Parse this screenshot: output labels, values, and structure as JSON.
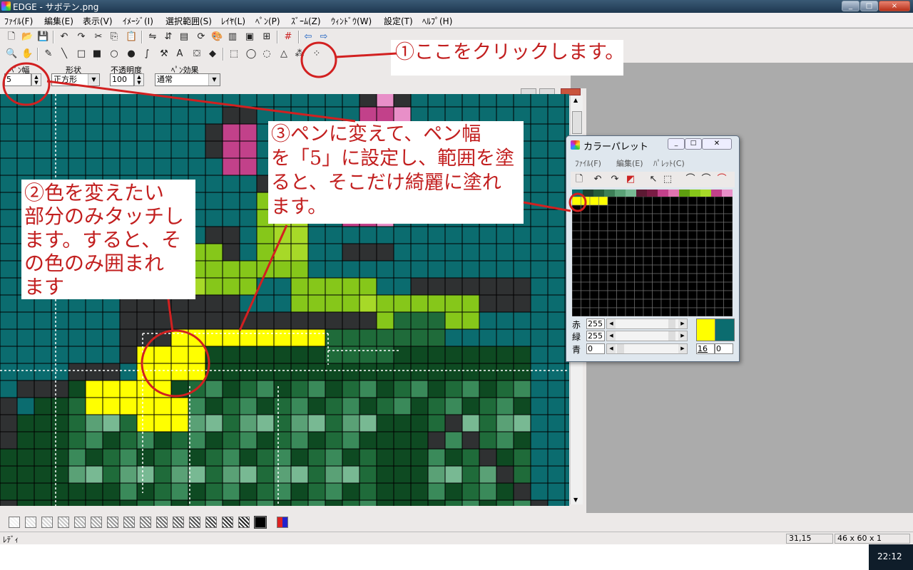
{
  "window": {
    "title": "EDGE - サボテン.png",
    "controls": [
      "_",
      "□",
      "×"
    ]
  },
  "menu": [
    "ﾌｧｲﾙ(F)",
    "編集(E)",
    "表示(V)",
    "ｲﾒｰｼﾞ(I)",
    "選択範囲(S)",
    "ﾚｲﾔ(L)",
    "ﾍﾟﾝ(P)",
    "ｽﾞｰﾑ(Z)",
    "ｳｨﾝﾄﾞｳ(W)",
    "設定(T)",
    "ﾍﾙﾌﾟ(H)"
  ],
  "toolbar1_icons": [
    "new-icon",
    "open-icon",
    "save-icon",
    "undo-icon",
    "redo-icon",
    "cut-icon",
    "copy-icon",
    "paste-icon",
    "flip-h-icon",
    "flip-v-icon",
    "scale-icon",
    "rotate-icon",
    "palette-icon",
    "layer-icon",
    "image-icon",
    "preview-icon",
    "grid-icon",
    "prev-icon",
    "next-icon"
  ],
  "toolbar2_icons": [
    "zoom-icon",
    "hand-icon",
    "pen-icon",
    "line-icon",
    "rect-icon",
    "filled-rect-icon",
    "circle-icon",
    "filled-circle-icon",
    "curve-icon",
    "hammer-icon",
    "text-icon",
    "bucket-icon",
    "fill-icon",
    "select-rect-icon",
    "select-circle-icon",
    "lasso-icon",
    "select-poly-icon",
    "magic-wand-icon",
    "color-select-icon"
  ],
  "pen_options": {
    "width_label": "ﾍﾟﾝ幅",
    "width_value": "5",
    "shape_label": "形状",
    "shape_value": "正方形",
    "opacity_label": "不透明度",
    "opacity_value": "100",
    "effect_label": "ﾍﾟﾝ効果",
    "effect_value": "通常"
  },
  "annotations": {
    "note1": "①ここをクリックします。",
    "note2": [
      "②色を変えたい",
      "部分のみタッチし",
      "ます。すると、そ",
      "の色のみ囲まれ",
      "ます"
    ],
    "note3": [
      "③ペンに変えて、ペン幅",
      "を「5」に設定し、範囲を塗",
      "ると、そこだけ綺麗に塗れ",
      "ます。"
    ],
    "accent_color": "#d22020"
  },
  "palette": {
    "title": "カラーパレット",
    "menu": [
      "ﾌｧｲﾙ(F)",
      "編集(E)",
      "ﾊﾟﾚｯﾄ(C)"
    ],
    "swatches": [
      "#0b6c6f",
      "#1d3f2e",
      "#265d3a",
      "#3d7f57",
      "#5aa176",
      "#78b993",
      "#5c1a33",
      "#7a1c44",
      "#c2418a",
      "#e074b0",
      "#5e9f10",
      "#86c71a",
      "#a7d928",
      "#c2418a",
      "#e88fc8"
    ],
    "selected_color": "#ffff00",
    "red_label": "赤",
    "red_value": "255",
    "green_label": "緑",
    "green_value": "255",
    "blue_label": "青",
    "blue_value": "0",
    "index": "16",
    "alpha": "0"
  },
  "status": {
    "text": "ﾚﾃﾞｨ",
    "coords": "31,15",
    "size": "46 x 60 x 1"
  },
  "clock": "22:12"
}
